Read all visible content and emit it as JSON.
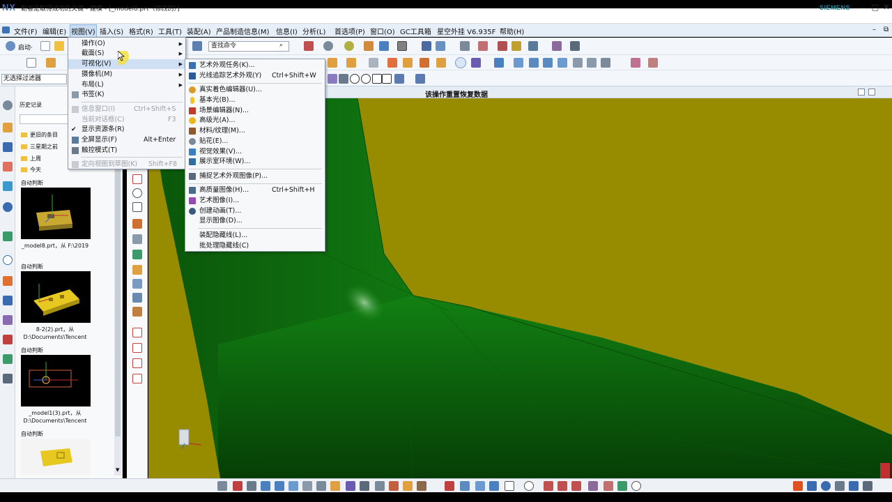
{
  "window": {
    "logo": "NX",
    "title": "勤者是取得成功的关键 - 建模 - [_model8.prt（修改的）]",
    "brand": "SIEMENS",
    "controls": [
      "–",
      "□",
      "✕"
    ]
  },
  "menubar": {
    "items": [
      "文件(F)",
      "编辑(E)",
      "视图(V)",
      "插入(S)",
      "格式(R)",
      "工具(T)",
      "装配(A)",
      "产品制造信息(M)",
      "信息(I)",
      "分析(L)",
      "首选项(P)",
      "窗口(O)",
      "GC工具箱",
      "星空外挂 V6.935F",
      "帮助(H)"
    ],
    "active": "视图(V)"
  },
  "toolbar": {
    "start_label": "启动·",
    "search_placeholder": "查找命令",
    "filter_value": "无选择过滤器"
  },
  "viewport": {
    "title": "该操作重置恢复数据"
  },
  "resource_panel": {
    "history_label": "历史记录",
    "folders": [
      "更旧的条目",
      "三星期之前",
      "上周",
      "今天"
    ],
    "cards": [
      {
        "tag": "自动判断",
        "caption": "_model8.prt，从 F:\\2019"
      },
      {
        "tag": "自动判断",
        "caption": "8-2(2).prt，从 D:\\Documents\\Tencent"
      },
      {
        "tag": "自动判断",
        "caption": "_model1(3).prt，从 D:\\Documents\\Tencent"
      },
      {
        "tag": "自动判断",
        "caption": ""
      }
    ]
  },
  "view_menu": {
    "items": [
      {
        "label": "操作(O)",
        "submenu": true,
        "enabled": true
      },
      {
        "label": "截面(S)",
        "submenu": true,
        "enabled": true
      },
      {
        "label": "可视化(V)",
        "submenu": true,
        "enabled": true,
        "highlighted": true
      },
      {
        "label": "摄像机(M)",
        "submenu": true,
        "enabled": true
      },
      {
        "label": "布局(L)",
        "submenu": true,
        "enabled": true
      },
      {
        "label": "书签(K)",
        "enabled": true
      },
      {
        "label": "信息窗口(I)",
        "shortcut": "Ctrl+Shift+S",
        "enabled": false
      },
      {
        "label": "当前对话框(C)",
        "shortcut": "F3",
        "enabled": false
      },
      {
        "label": "显示资源条(R)",
        "enabled": true,
        "checked": true
      },
      {
        "label": "全屏显示(F)",
        "shortcut": "Alt+Enter",
        "enabled": true
      },
      {
        "label": "触控模式(T)",
        "enabled": true
      },
      {
        "label": "定向视图到草图(K)",
        "shortcut": "Shift+F8",
        "enabled": false
      }
    ]
  },
  "visualization_menu": {
    "groups": [
      [
        {
          "label": "艺术外观任务(K)...",
          "icon_color": "#3a6fb0"
        },
        {
          "label": "光线追踪艺术外观(Y)",
          "shortcut": "Ctrl+Shift+W",
          "icon_color": "#2a5a9a"
        }
      ],
      [
        {
          "label": "真实着色编辑器(U)...",
          "icon_color": "#d89a2a"
        },
        {
          "label": "基本光(B)...",
          "icon_color": "#f2c230"
        },
        {
          "label": "场景编辑器(N)...",
          "icon_color": "#c0392b"
        },
        {
          "label": "高级光(A)...",
          "icon_color": "#e8b820"
        },
        {
          "label": "材料/纹理(M)...",
          "icon_color": "#8e5a2a"
        },
        {
          "label": "贴花(E)...",
          "icon_color": "#7a8a9a"
        },
        {
          "label": "视觉效果(V)...",
          "icon_color": "#3d7fc0"
        },
        {
          "label": "展示室环境(W)...",
          "icon_color": "#2f6fa0"
        }
      ],
      [
        {
          "label": "捕捉艺术外观图像(P)...",
          "icon_color": "#5a6a7a"
        }
      ],
      [
        {
          "label": "高质量图像(H)...",
          "shortcut": "Ctrl+Shift+H",
          "icon_color": "#4a6a8a"
        },
        {
          "label": "艺术图像(I)...",
          "icon_color": "#9a4ab0"
        },
        {
          "label": "创建动画(T)...",
          "icon_color": "#3a5a7a"
        },
        {
          "label": "显示图像(D)...",
          "icon_color": ""
        }
      ],
      [
        {
          "label": "装配隐藏线(L)...",
          "icon_color": ""
        },
        {
          "label": "批处理隐藏线(C)",
          "icon_color": ""
        }
      ]
    ]
  },
  "colors": {
    "background_olive": "#978c00",
    "model_green": "#0e6e0e",
    "menu_highlight": "#cfe0f4"
  }
}
